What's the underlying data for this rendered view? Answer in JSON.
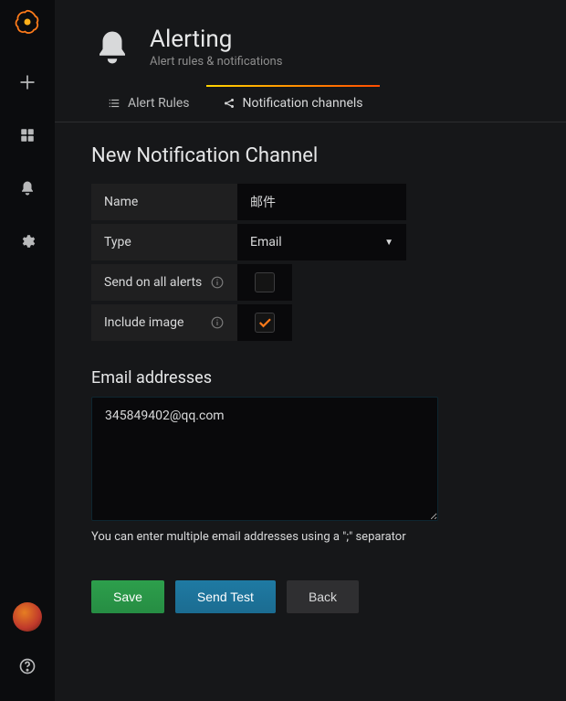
{
  "header": {
    "title": "Alerting",
    "subtitle": "Alert rules & notifications"
  },
  "tabs": {
    "rules": "Alert Rules",
    "channels": "Notification channels"
  },
  "page": {
    "heading": "New Notification Channel"
  },
  "form": {
    "name_label": "Name",
    "name_value": "邮件",
    "type_label": "Type",
    "type_value": "Email",
    "send_all_label": "Send on all alerts",
    "send_all_checked": false,
    "include_image_label": "Include image",
    "include_image_checked": true
  },
  "email": {
    "section": "Email addresses",
    "value": "345849402@qq.com",
    "hint": "You can enter multiple email addresses using a \";\" separator"
  },
  "buttons": {
    "save": "Save",
    "test": "Send Test",
    "back": "Back"
  }
}
